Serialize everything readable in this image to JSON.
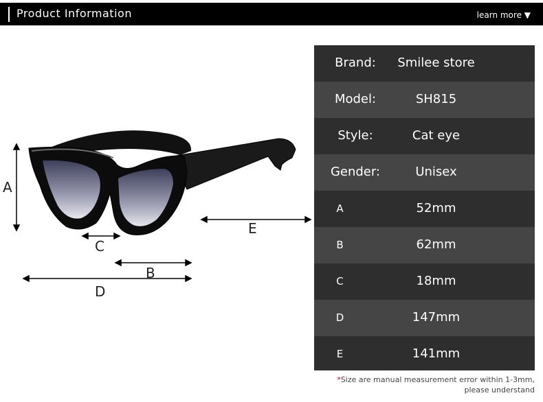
{
  "header": {
    "title": "Product Information",
    "learn_more": "learn more ▼"
  },
  "dimension_labels": {
    "a": "A",
    "b": "B",
    "c": "C",
    "d": "D",
    "e": "E"
  },
  "specs": [
    {
      "label": "Brand:",
      "value": "Smilee store"
    },
    {
      "label": "Model:",
      "value": "SH815"
    },
    {
      "label": "Style:",
      "value": "Cat eye"
    },
    {
      "label": "Gender:",
      "value": "Unisex"
    },
    {
      "label": "A",
      "value": "52mm"
    },
    {
      "label": "B",
      "value": "62mm"
    },
    {
      "label": "C",
      "value": "18mm"
    },
    {
      "label": "D",
      "value": "147mm"
    },
    {
      "label": "E",
      "value": "141mm"
    }
  ],
  "footnote": {
    "star": "*",
    "line1": "Size are manual measurement error within 1-3mm,",
    "line2": "please understand"
  },
  "colors": {
    "header_bg": "#000000",
    "row_dark": "#2e2e2e",
    "row_light": "#454545",
    "footnote_star": "#d0021b"
  }
}
